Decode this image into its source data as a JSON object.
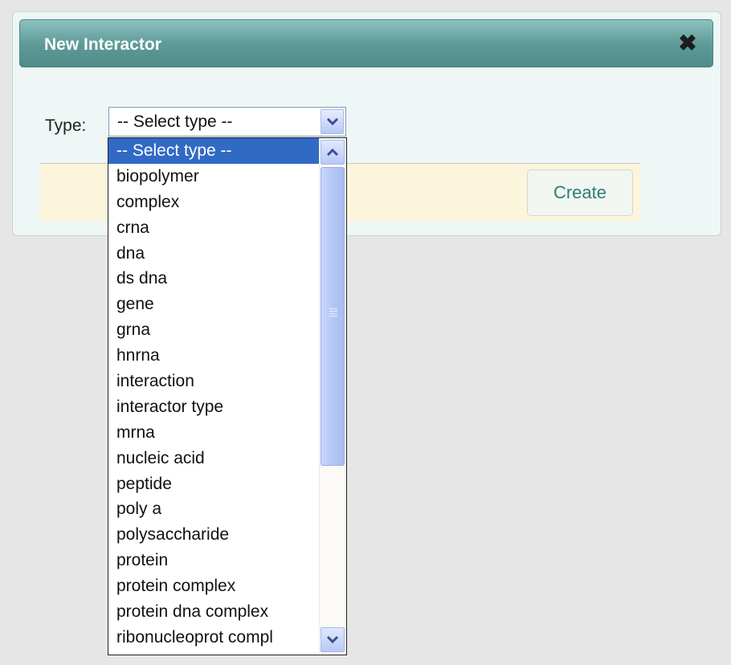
{
  "dialog": {
    "title": "New Interactor",
    "close_icon": "close-icon"
  },
  "form": {
    "type_label": "Type:",
    "select_value": "-- Select type --"
  },
  "actions": {
    "create_label": "Create"
  },
  "dropdown": {
    "options": [
      "-- Select type --",
      "biopolymer",
      "complex",
      "crna",
      "dna",
      "ds dna",
      "gene",
      "grna",
      "hnrna",
      "interaction",
      "interactor type",
      "mrna",
      "nucleic acid",
      "peptide",
      "poly a",
      "polysaccharide",
      "protein",
      "protein complex",
      "protein dna complex",
      "ribonucleoprot compl"
    ],
    "selected_index": 0
  },
  "colors": {
    "titlebar": "#5f9c99",
    "selection": "#316ac5",
    "footer": "#fbf5dc",
    "button_text": "#2e7c7c"
  }
}
